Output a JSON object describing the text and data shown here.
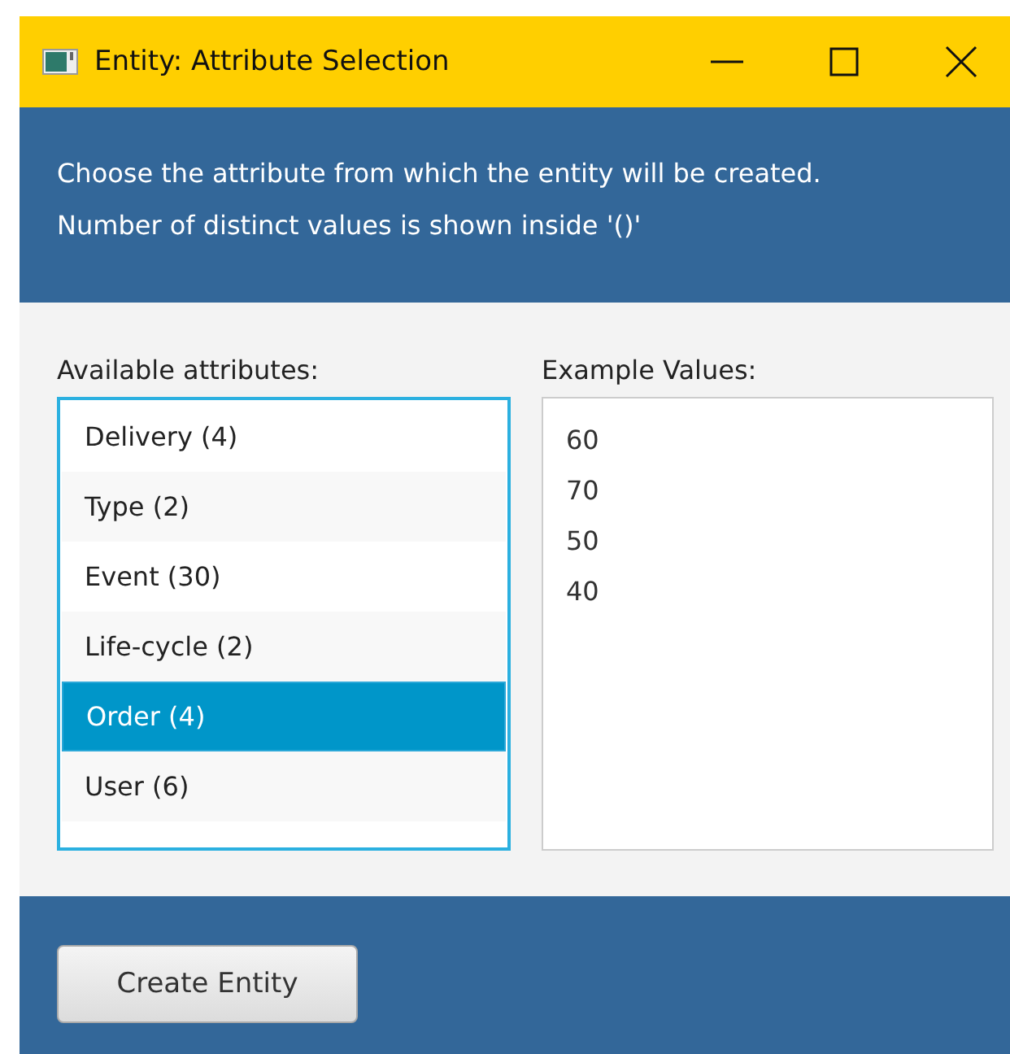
{
  "window": {
    "title": "Entity: Attribute Selection"
  },
  "header": {
    "lines": [
      "Choose the attribute from which the entity will be created.",
      "Number of distinct values is shown inside '()'"
    ]
  },
  "attributes": {
    "label": "Available attributes:",
    "items": [
      {
        "label": "Delivery (4)",
        "selected": false
      },
      {
        "label": "Type (2)",
        "selected": false
      },
      {
        "label": "Event (30)",
        "selected": false
      },
      {
        "label": "Life-cycle (2)",
        "selected": false
      },
      {
        "label": "Order (4)",
        "selected": true
      },
      {
        "label": "User (6)",
        "selected": false
      }
    ]
  },
  "examples": {
    "label": "Example Values:",
    "values": [
      "60",
      "70",
      "50",
      "40"
    ]
  },
  "buttons": [
    "Create Entity"
  ]
}
